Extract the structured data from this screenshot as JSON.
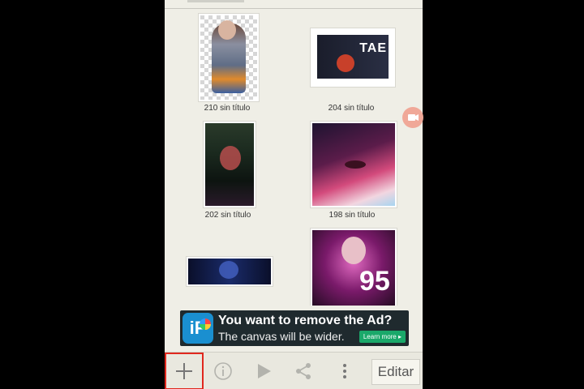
{
  "gallery": {
    "items": [
      {
        "caption": "210 sin título"
      },
      {
        "caption": "204 sin título",
        "art_text": "TAE"
      },
      {
        "caption": "202 sin título"
      },
      {
        "caption": "198 sin título"
      },
      {
        "caption": ""
      },
      {
        "caption": "",
        "art_text": "95"
      }
    ]
  },
  "ad": {
    "headline": "You want to remove the Ad?",
    "subline": "The canvas will be wider.",
    "cta": "Learn more ▸",
    "logo": "iP"
  },
  "toolbar": {
    "add_icon": "plus-icon",
    "info_icon": "info-icon",
    "play_icon": "play-icon",
    "share_icon": "share-icon",
    "more_icon": "more-vertical-icon",
    "edit_label": "Editar"
  },
  "colors": {
    "highlight": "#e0281e",
    "background": "#efeee6"
  }
}
